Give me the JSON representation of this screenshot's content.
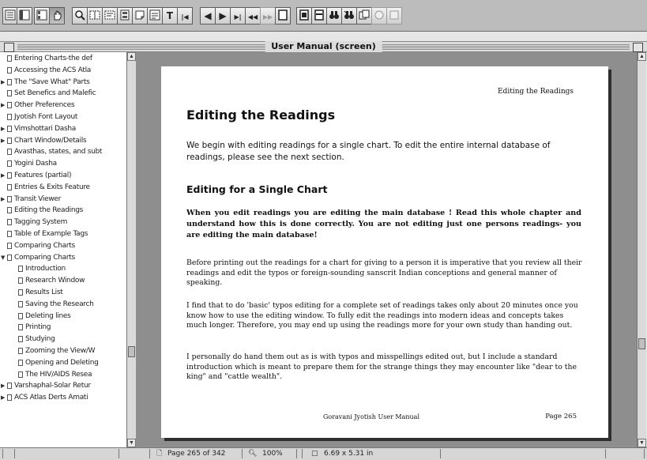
{
  "toolbar": {
    "buttons": [
      {
        "name": "toc-panel-button",
        "icon": "list-icon"
      },
      {
        "name": "split-panel-button",
        "icon": "panels-icon"
      },
      {
        "name": "thumbnails-button",
        "icon": "thumbnails-icon"
      },
      {
        "name": "hand-tool-button",
        "icon": "hand-icon"
      },
      {
        "name": "zoom-tool-button",
        "icon": "magnifier-icon"
      },
      {
        "name": "select-column-button",
        "icon": "columns-icon"
      },
      {
        "name": "select-text-button",
        "icon": "select-icon"
      },
      {
        "name": "form-button",
        "icon": "form-icon"
      },
      {
        "name": "note-button",
        "icon": "note-icon"
      },
      {
        "name": "image-select-button",
        "icon": "image-icon"
      },
      {
        "name": "text-tool-button",
        "glyph": "T"
      },
      {
        "name": "first-page-button",
        "glyph": "|◀"
      },
      {
        "name": "prev-page-button",
        "glyph": "◀"
      },
      {
        "name": "next-page-button",
        "glyph": "▶"
      },
      {
        "name": "last-page-button",
        "glyph": "▶|"
      },
      {
        "name": "go-back-button",
        "glyph": "◀◀"
      },
      {
        "name": "go-forward-button",
        "glyph": "▶▶"
      },
      {
        "name": "actual-size-button",
        "icon": "actual-size-icon"
      },
      {
        "name": "fit-page-button",
        "icon": "fit-page-icon"
      },
      {
        "name": "fit-width-button",
        "icon": "fit-width-icon"
      },
      {
        "name": "find-button",
        "icon": "binoculars-icon"
      },
      {
        "name": "search-button",
        "icon": "search-icon"
      },
      {
        "name": "copy-button",
        "icon": "copy-icon"
      },
      {
        "name": "link-button",
        "icon": "link-icon"
      },
      {
        "name": "info-button",
        "icon": "info-icon"
      }
    ]
  },
  "window": {
    "title": "User Manual (screen)"
  },
  "outline": {
    "items": [
      {
        "label": "Entering Charts-the def",
        "indent": 0,
        "expandable": false
      },
      {
        "label": "Accessing the ACS Atla",
        "indent": 0,
        "expandable": false
      },
      {
        "label": "The \"Save What\" Parts",
        "indent": 0,
        "expandable": true
      },
      {
        "label": "Set Benefics and Malefic",
        "indent": 0,
        "expandable": false
      },
      {
        "label": "Other Preferences",
        "indent": 0,
        "expandable": true
      },
      {
        "label": "Jyotish Font Layout",
        "indent": 0,
        "expandable": false
      },
      {
        "label": "Vimshottari Dasha",
        "indent": 0,
        "expandable": true
      },
      {
        "label": "Chart Window/Details",
        "indent": 0,
        "expandable": true
      },
      {
        "label": "Avasthas, states, and subt",
        "indent": 0,
        "expandable": false
      },
      {
        "label": "Yogini Dasha",
        "indent": 0,
        "expandable": false
      },
      {
        "label": "Features (partial)",
        "indent": 0,
        "expandable": true
      },
      {
        "label": "Entries & Exits Feature",
        "indent": 0,
        "expandable": false
      },
      {
        "label": "Transit Viewer",
        "indent": 0,
        "expandable": true
      },
      {
        "label": "Editing the Readings",
        "indent": 0,
        "expandable": false
      },
      {
        "label": "Tagging System",
        "indent": 0,
        "expandable": false
      },
      {
        "label": "Table of Example Tags",
        "indent": 0,
        "expandable": false
      },
      {
        "label": "Comparing Charts",
        "indent": 0,
        "expandable": false
      },
      {
        "label": "Comparing Charts",
        "indent": 0,
        "expandable": true,
        "expanded": true
      },
      {
        "label": "Introduction",
        "indent": 1,
        "expandable": false
      },
      {
        "label": "Research Window",
        "indent": 1,
        "expandable": false
      },
      {
        "label": "Results List",
        "indent": 1,
        "expandable": false
      },
      {
        "label": "Saving the Research",
        "indent": 1,
        "expandable": false
      },
      {
        "label": "Deleting lines",
        "indent": 1,
        "expandable": false
      },
      {
        "label": "Printing",
        "indent": 1,
        "expandable": false
      },
      {
        "label": "Studying",
        "indent": 1,
        "expandable": false
      },
      {
        "label": "Zooming the View/W",
        "indent": 1,
        "expandable": false
      },
      {
        "label": "Opening and Deleting",
        "indent": 1,
        "expandable": false
      },
      {
        "label": "The HIV/AIDS Resea",
        "indent": 1,
        "expandable": false
      },
      {
        "label": "Varshaphal-Solar Retur",
        "indent": 0,
        "expandable": true
      },
      {
        "label": "ACS Atlas Derts Amati",
        "indent": 0,
        "expandable": true
      }
    ]
  },
  "page": {
    "running_head": "Editing the Readings",
    "heading": "Editing the Readings",
    "intro": "We begin with editing readings for a single chart.  To edit the entire internal database of readings, please see the next section.",
    "subheading": "Editing for a Single Chart",
    "warning": "When you edit readings you are editing the main database !  Read this whole chapter and understand how this is done correctly.  You are not editing just one persons readings- you are editing the main database!",
    "para1": "Before printing out the readings for a chart for giving to a person it is imperative that you review all their readings and edit the typos or foreign-sounding sanscrit Indian conceptions and general manner of speaking.",
    "para2": "I find that to do 'basic' typos editing for a complete set of readings takes only about 20 minutes once you know how to use the editing window.  To fully edit the readings into modern ideas and concepts takes much longer.  Therefore, you may end up using the readings more for your own study than handing out.",
    "para3": "I personally do hand them out as is with typos and misspellings edited out, but I include a standard introduction which is meant to prepare them for the strange things they may encounter like \"dear to the king\" and \"cattle wealth\".",
    "footer_left": "Goravani Jyotish User Manual",
    "footer_right": "Page 265"
  },
  "status": {
    "page": "Page 265 of 342",
    "zoom": "100%",
    "size": "6.69 x 5.31 in"
  }
}
